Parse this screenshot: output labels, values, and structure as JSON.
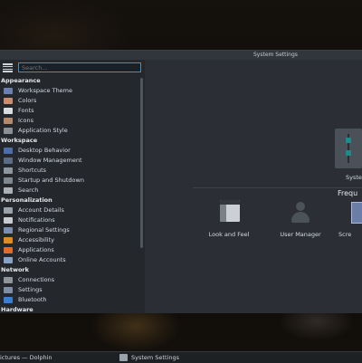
{
  "window": {
    "title": "System Settings"
  },
  "search": {
    "placeholder": "Search..."
  },
  "sidebar": {
    "sections": [
      {
        "label": "Appearance",
        "items": [
          {
            "label": "Workspace Theme",
            "icon": "workspace-theme-icon",
            "color": "#6c7fb1"
          },
          {
            "label": "Colors",
            "icon": "colors-icon",
            "color": "#c98d6f"
          },
          {
            "label": "Fonts",
            "icon": "fonts-icon",
            "color": "#d9dde1"
          },
          {
            "label": "Icons",
            "icon": "icons-icon",
            "color": "#b48a6a"
          },
          {
            "label": "Application Style",
            "icon": "application-style-icon",
            "color": "#8b9097"
          }
        ]
      },
      {
        "label": "Workspace",
        "items": [
          {
            "label": "Desktop Behavior",
            "icon": "desktop-behavior-icon",
            "color": "#4d6fa8"
          },
          {
            "label": "Window Management",
            "icon": "window-management-icon",
            "color": "#5c6b86"
          },
          {
            "label": "Shortcuts",
            "icon": "shortcuts-icon",
            "color": "#8f959c"
          },
          {
            "label": "Startup and Shutdown",
            "icon": "startup-shutdown-icon",
            "color": "#7f8790"
          },
          {
            "label": "Search",
            "icon": "search-icon",
            "color": "#aab0b8"
          }
        ]
      },
      {
        "label": "Personalization",
        "items": [
          {
            "label": "Account Details",
            "icon": "account-details-icon",
            "color": "#9ba2aa"
          },
          {
            "label": "Notifications",
            "icon": "notifications-icon",
            "color": "#c8ccd1"
          },
          {
            "label": "Regional Settings",
            "icon": "regional-settings-icon",
            "color": "#7c8fb3"
          },
          {
            "label": "Accessibility",
            "icon": "accessibility-icon",
            "color": "#e08a2e"
          },
          {
            "label": "Applications",
            "icon": "applications-icon",
            "color": "#e06b2a"
          },
          {
            "label": "Online Accounts",
            "icon": "online-accounts-icon",
            "color": "#8aa3c4"
          }
        ]
      },
      {
        "label": "Network",
        "items": [
          {
            "label": "Connections",
            "icon": "connections-icon",
            "color": "#8f959c"
          },
          {
            "label": "Settings",
            "icon": "settings-icon",
            "color": "#7f8ea5"
          },
          {
            "label": "Bluetooth",
            "icon": "bluetooth-icon",
            "color": "#3b7fd1"
          }
        ]
      },
      {
        "label": "Hardware",
        "items": []
      }
    ]
  },
  "main": {
    "hero_label": "Syste",
    "frequent_label": "Frequ",
    "tiles": [
      {
        "label": "Look and Feel",
        "icon": "look-and-feel-icon"
      },
      {
        "label": "User Manager",
        "icon": "user-manager-icon"
      },
      {
        "label": "Scre",
        "icon": "screen-icon"
      }
    ]
  },
  "taskbar": {
    "tasks": [
      {
        "label": "ictures — Dolphin"
      },
      {
        "label": "System Settings"
      }
    ]
  }
}
